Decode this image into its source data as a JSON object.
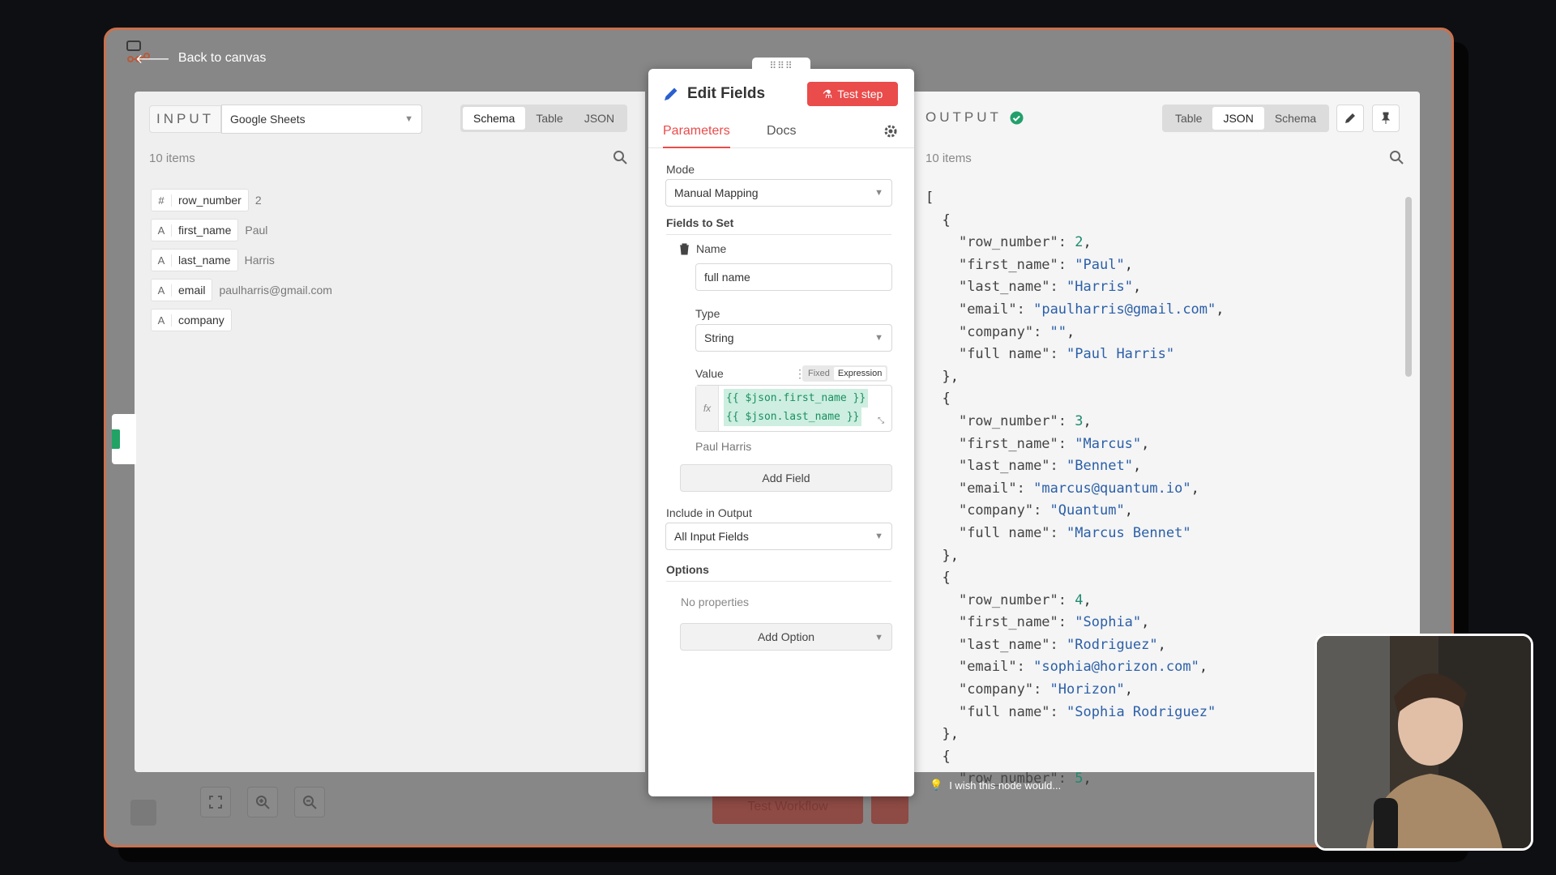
{
  "back_label": "Back to canvas",
  "input": {
    "caption": "INPUT",
    "source": "Google Sheets",
    "views": [
      "Schema",
      "Table",
      "JSON"
    ],
    "active_view": "Schema",
    "count": "10 items",
    "fields": [
      {
        "type": "#",
        "name": "row_number",
        "value": "2"
      },
      {
        "type": "A",
        "name": "first_name",
        "value": "Paul"
      },
      {
        "type": "A",
        "name": "last_name",
        "value": "Harris"
      },
      {
        "type": "A",
        "name": "email",
        "value": "paulharris@gmail.com"
      },
      {
        "type": "A",
        "name": "company",
        "value": ""
      }
    ]
  },
  "edit": {
    "title": "Edit Fields",
    "test_step": "Test step",
    "tabs": [
      "Parameters",
      "Docs"
    ],
    "active_tab": "Parameters",
    "mode_label": "Mode",
    "mode_value": "Manual Mapping",
    "fields_to_set": "Fields to Set",
    "name_label": "Name",
    "name_value": "full name",
    "type_label": "Type",
    "type_value": "String",
    "value_label": "Value",
    "fixed": "Fixed",
    "expression": "Expression",
    "fx": "fx",
    "expr_line1": "{{ $json.first_name }}",
    "expr_line2": "{{ $json.last_name }}",
    "preview": "Paul Harris",
    "add_field": "Add Field",
    "include_label": "Include in Output",
    "include_value": "All Input Fields",
    "options_label": "Options",
    "no_props": "No properties",
    "add_option": "Add Option"
  },
  "output": {
    "caption": "OUTPUT",
    "views": [
      "Table",
      "JSON",
      "Schema"
    ],
    "active_view": "JSON",
    "count": "10 items",
    "records": [
      {
        "row_number": "2",
        "first_name": "Paul",
        "last_name": "Harris",
        "email": "paulharris@gmail.com",
        "company": "",
        "full_name": "Paul Harris"
      },
      {
        "row_number": "3",
        "first_name": "Marcus",
        "last_name": "Bennet",
        "email": "marcus@quantum.io",
        "company": "Quantum",
        "full_name": "Marcus Bennet"
      },
      {
        "row_number": "4",
        "first_name": "Sophia",
        "last_name": "Rodriguez",
        "email": "sophia@horizon.com",
        "company": "Horizon",
        "full_name": "Sophia Rodriguez"
      },
      {
        "row_number": "5"
      }
    ],
    "feedback": "I wish this node would..."
  },
  "canvas_button": "Test Workflow",
  "colors": {
    "accent": "#ea4b4b",
    "link": "#2b5fa8",
    "number": "#1d8a6e",
    "frame": "#c9714e",
    "success": "#22a06b"
  }
}
